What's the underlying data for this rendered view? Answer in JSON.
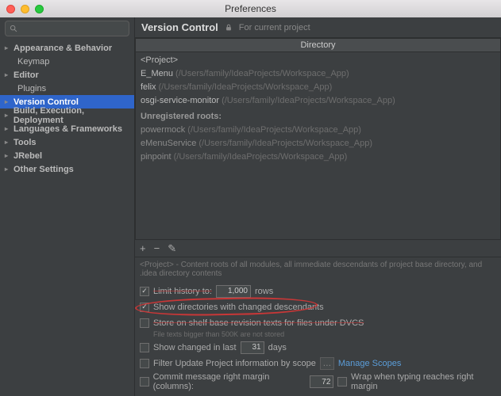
{
  "window": {
    "title": "Preferences"
  },
  "sidebar": {
    "search_placeholder": "",
    "items": [
      {
        "label": "Appearance & Behavior",
        "expandable": true,
        "bold": true
      },
      {
        "label": "Keymap",
        "expandable": false,
        "bold": false,
        "child": true
      },
      {
        "label": "Editor",
        "expandable": true,
        "bold": true
      },
      {
        "label": "Plugins",
        "expandable": false,
        "bold": false,
        "child": true
      },
      {
        "label": "Version Control",
        "expandable": true,
        "bold": true,
        "selected": true
      },
      {
        "label": "Build, Execution, Deployment",
        "expandable": true,
        "bold": true
      },
      {
        "label": "Languages & Frameworks",
        "expandable": true,
        "bold": true
      },
      {
        "label": "Tools",
        "expandable": true,
        "bold": true
      },
      {
        "label": "JRebel",
        "expandable": true,
        "bold": true
      },
      {
        "label": "Other Settings",
        "expandable": true,
        "bold": true
      }
    ]
  },
  "main": {
    "title": "Version Control",
    "subtitle": "For current project",
    "column_header": "Directory",
    "rows": [
      {
        "name": "<Project>",
        "path": ""
      },
      {
        "name": "E_Menu",
        "path": "(/Users/family/IdeaProjects/Workspace_App)"
      },
      {
        "name": "felix",
        "path": "(/Users/family/IdeaProjects/Workspace_App)"
      },
      {
        "name": "osgi-service-monitor",
        "path": "(/Users/family/IdeaProjects/Workspace_App)"
      }
    ],
    "unregistered_heading": "Unregistered roots:",
    "unregistered": [
      {
        "name": "powermock",
        "path": "(/Users/family/IdeaProjects/Workspace_App)"
      },
      {
        "name": "eMenuService",
        "path": "(/Users/family/IdeaProjects/Workspace_App)"
      },
      {
        "name": "pinpoint",
        "path": "(/Users/family/IdeaProjects/Workspace_App)"
      }
    ],
    "toolbar": {
      "add": "+",
      "remove": "−",
      "edit": "✎"
    },
    "hint": "<Project> - Content roots of all modules, all immediate descendants of project base directory, and .idea directory contents",
    "opt_limit": {
      "label_a": "Limit history to:",
      "value": "1,000",
      "label_b": "rows",
      "checked": true
    },
    "opt_show_dirs": {
      "label": "Show directories with changed descendants",
      "checked": true
    },
    "opt_shelf": {
      "label": "Store on shelf base revision texts for files under DVCS",
      "checked": false,
      "note": "File texts bigger than 500K are not stored"
    },
    "opt_changed": {
      "label_a": "Show changed in last",
      "value": "31",
      "label_b": "days",
      "checked": false
    },
    "opt_filter": {
      "label": "Filter Update Project information by scope",
      "checked": false,
      "btn": "…",
      "link": "Manage Scopes"
    },
    "opt_commit": {
      "label": "Commit message right margin (columns):",
      "value": "72",
      "checked": false,
      "wrap_label": "Wrap when typing reaches right margin",
      "wrap_checked": false
    }
  }
}
